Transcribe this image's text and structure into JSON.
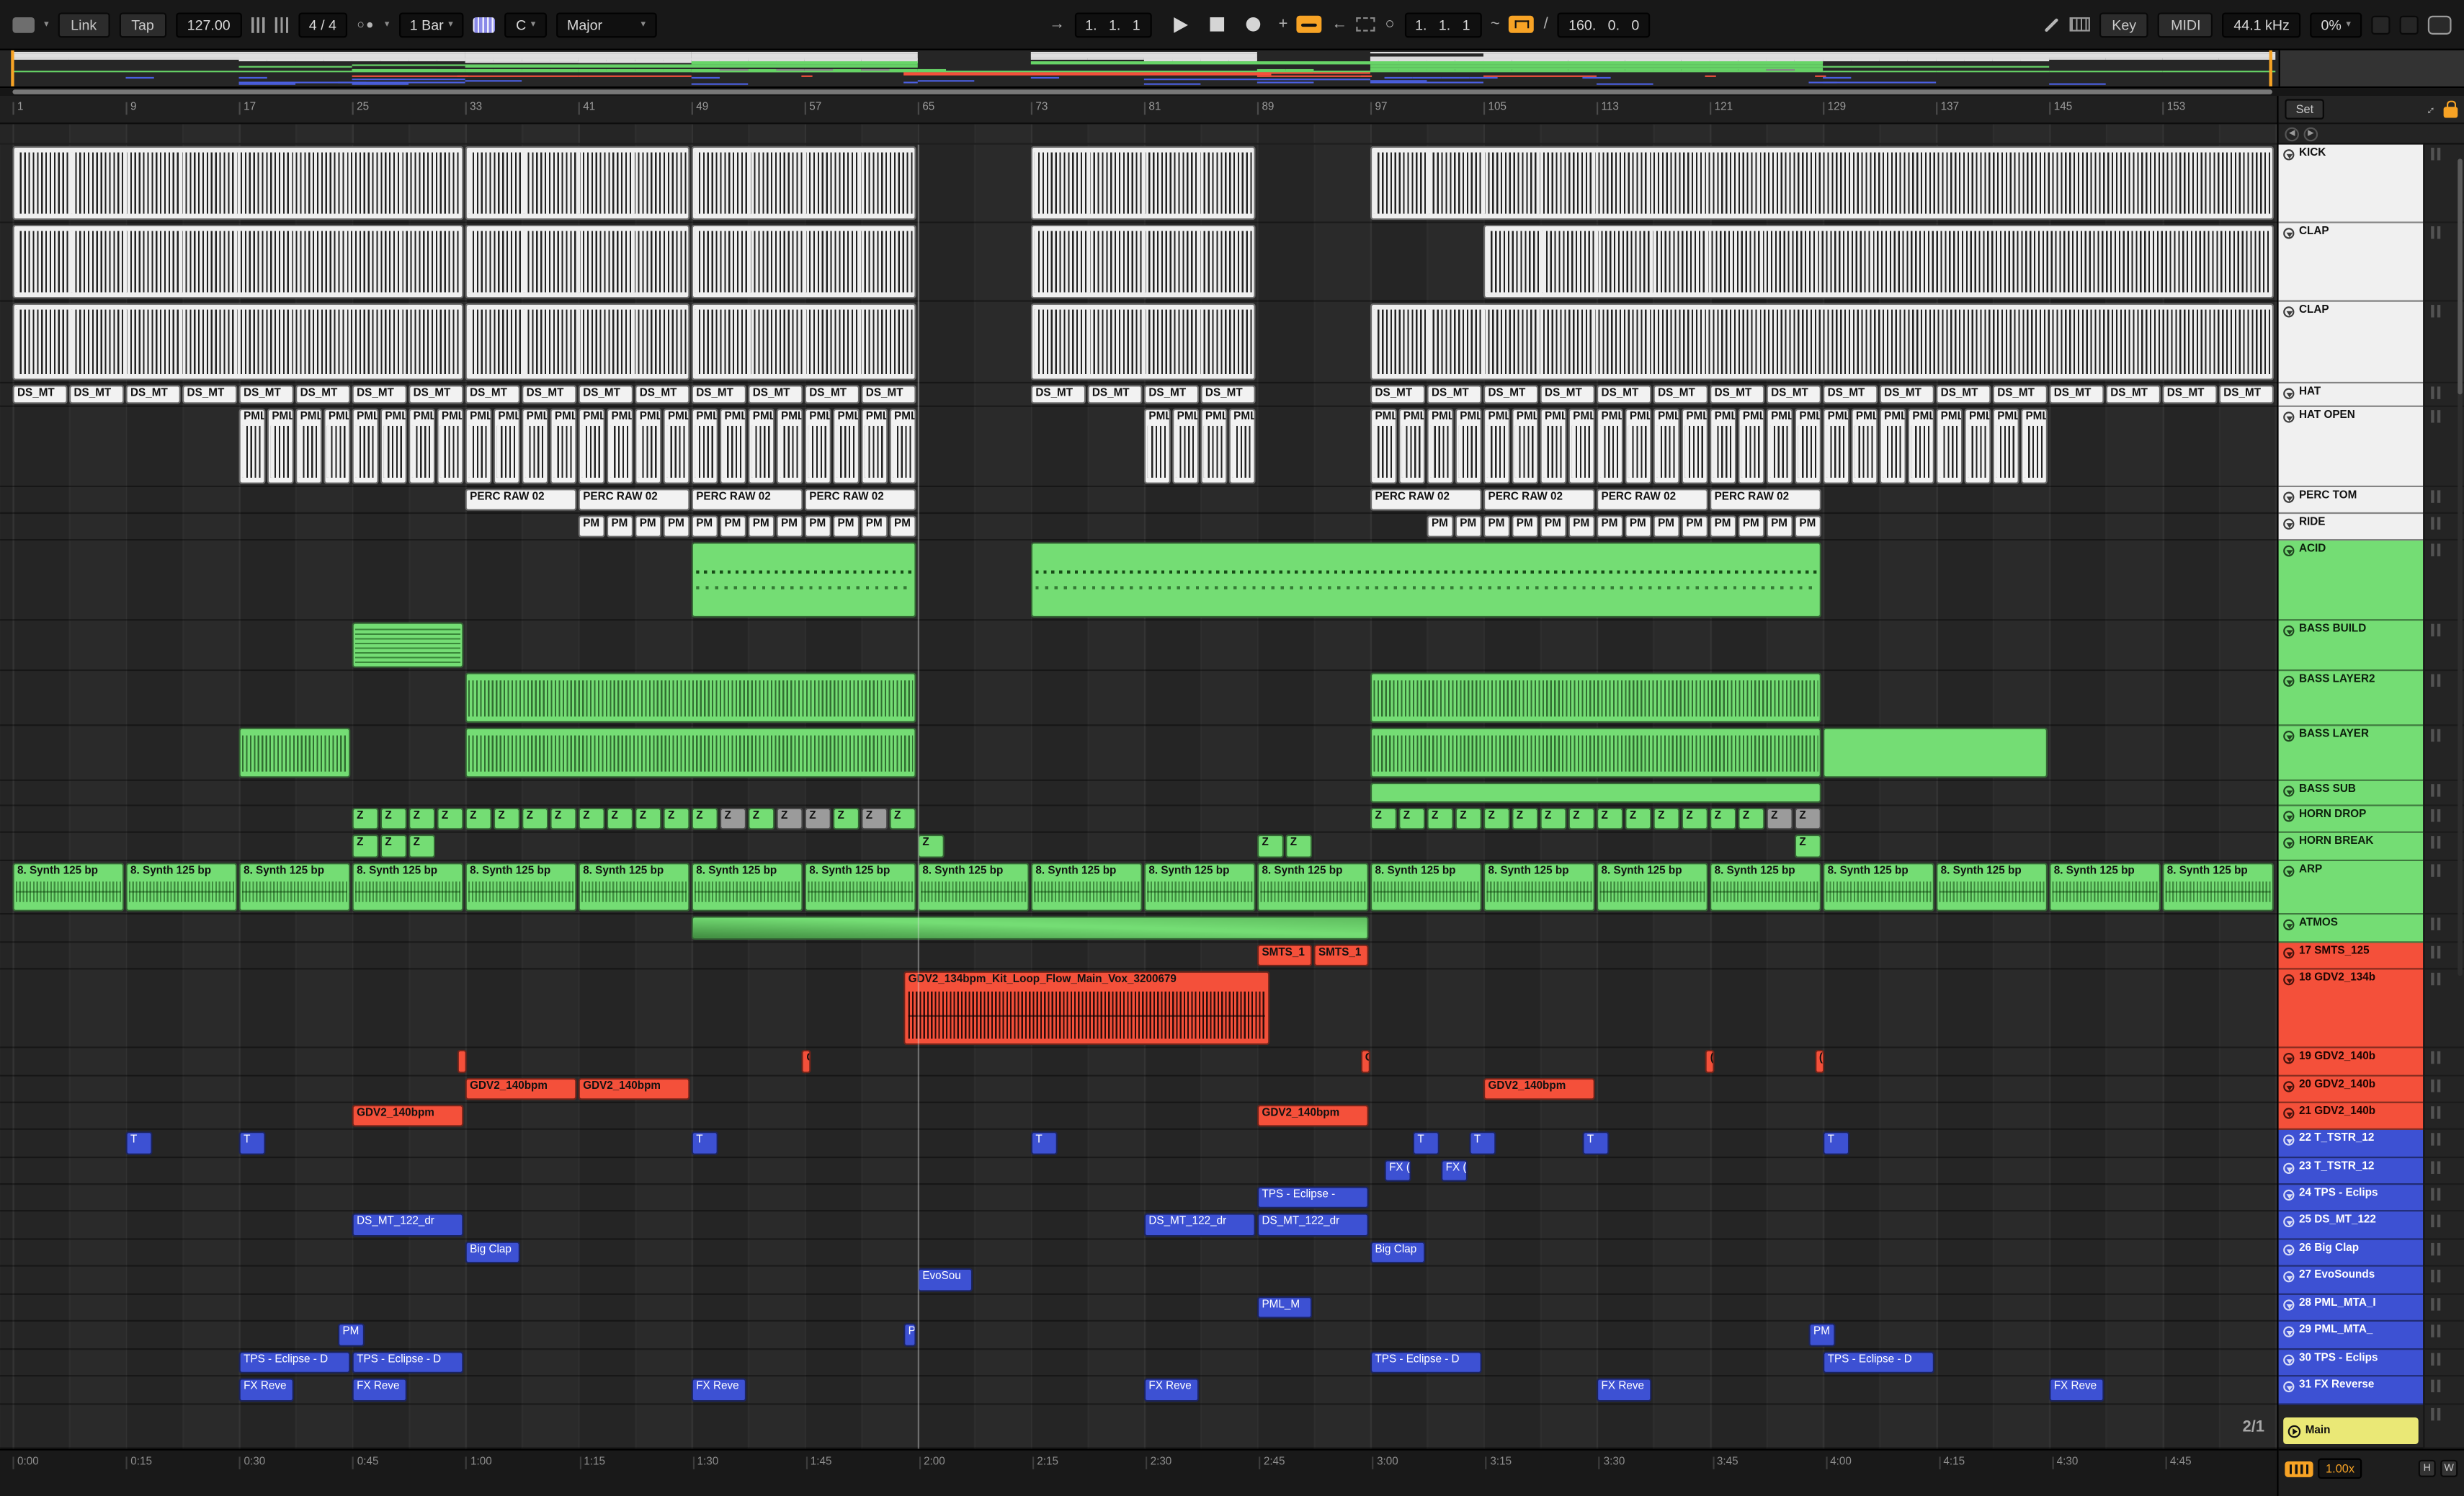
{
  "toolbar": {
    "link": "Link",
    "tap": "Tap",
    "tempo": "127.00",
    "time_sig": "4 / 4",
    "groove": "1 Bar",
    "root_note": "C",
    "scale_name": "Major",
    "arrangement_position": "1.   1.   1",
    "loop_start": "1.   1.   1",
    "loop_length": "160.   0.   0",
    "key_map": "Key",
    "midi_map": "MIDI",
    "sample_rate": "44.1 kHz",
    "cpu_load": "0%"
  },
  "arrangement": {
    "set_button": "Set",
    "grid_label": "2/1",
    "bars_total": 160,
    "ruler_bars": [
      1,
      9,
      17,
      25,
      33,
      41,
      49,
      57,
      65,
      73,
      81,
      89,
      97,
      105,
      113,
      121,
      129,
      137,
      145,
      153
    ],
    "time_labels": [
      "0:00",
      "0:15",
      "0:30",
      "0:45",
      "1:00",
      "1:15",
      "1:30",
      "1:45",
      "2:00",
      "2:15",
      "2:30",
      "2:45",
      "3:00",
      "3:15",
      "3:30",
      "3:45",
      "4:00",
      "4:15",
      "4:30",
      "4:45"
    ]
  },
  "status_bar": {
    "speed": "1.00x",
    "h": "H",
    "w": "W",
    "main": "Main"
  },
  "colors": {
    "light": "#f0f0f0",
    "green": "#74dd74",
    "red": "#f4503a",
    "blue": "#3d51d3",
    "yellow": "#eae876",
    "accent_orange": "#f7a325",
    "background": "#2a2a2a",
    "mini": {
      "light": "#dedede",
      "green": "#67d467",
      "red": "#f4513b",
      "blue": "#4a5fe0",
      "yellow": "#eae876"
    }
  },
  "tracks": [
    {
      "name": "KICK",
      "color": "light",
      "h": 50,
      "style": "wave-light",
      "clips": [
        {
          "s": 1,
          "l": 32
        },
        {
          "s": 33,
          "l": 16
        },
        {
          "s": 49,
          "l": 16
        },
        {
          "s": 73,
          "l": 16
        },
        {
          "s": 97,
          "l": 64
        }
      ]
    },
    {
      "name": "CLAP",
      "color": "light",
      "h": 50,
      "style": "wave-light",
      "clips": [
        {
          "s": 1,
          "l": 32
        },
        {
          "s": 33,
          "l": 16
        },
        {
          "s": 49,
          "l": 16
        },
        {
          "s": 73,
          "l": 16
        },
        {
          "s": 105,
          "l": 56
        }
      ]
    },
    {
      "name": "CLAP",
      "color": "light",
      "h": 52,
      "style": "wave-light",
      "clips": [
        {
          "s": 1,
          "l": 32
        },
        {
          "s": 33,
          "l": 16
        },
        {
          "s": 49,
          "l": 16
        },
        {
          "s": 73,
          "l": 16
        },
        {
          "s": 97,
          "l": 64
        }
      ]
    },
    {
      "name": "HAT",
      "color": "light",
      "h": 15,
      "style": "label-light",
      "clips": [
        {
          "run": {
            "s": 1,
            "count": 16,
            "step": 4,
            "l": 4,
            "label": "DS_MT"
          }
        },
        {
          "run": {
            "s": 73,
            "count": 4,
            "step": 4,
            "l": 4,
            "label": "DS_MT"
          }
        },
        {
          "run": {
            "s": 97,
            "count": 16,
            "step": 4,
            "l": 4,
            "label": "DS_MT"
          }
        }
      ]
    },
    {
      "name": "HAT OPEN",
      "color": "light",
      "h": 51,
      "style": "wave-light-label",
      "clips": [
        {
          "run": {
            "s": 17,
            "count": 24,
            "step": 2,
            "l": 2,
            "label": "PML_M"
          }
        },
        {
          "run": {
            "s": 81,
            "count": 4,
            "step": 2,
            "l": 2,
            "label": "PML_M"
          }
        },
        {
          "run": {
            "s": 97,
            "count": 24,
            "step": 2,
            "l": 2,
            "label": "PML_M"
          }
        }
      ]
    },
    {
      "name": "PERC TOM",
      "color": "light",
      "h": 17,
      "style": "label-light",
      "clips": [
        {
          "run": {
            "s": 33,
            "count": 4,
            "step": 8,
            "l": 8,
            "label": "PERC RAW 02"
          }
        },
        {
          "run": {
            "s": 97,
            "count": 4,
            "step": 8,
            "l": 8,
            "label": "PERC RAW 02"
          }
        }
      ]
    },
    {
      "name": "RIDE",
      "color": "light",
      "h": 17,
      "style": "label-light",
      "clips": [
        {
          "run": {
            "s": 41,
            "count": 12,
            "step": 2,
            "l": 2,
            "label": "PM"
          }
        },
        {
          "run": {
            "s": 101,
            "count": 14,
            "step": 2,
            "l": 2,
            "label": "PM"
          }
        }
      ]
    },
    {
      "name": "ACID",
      "color": "green",
      "h": 51,
      "style": "midi-green",
      "clips": [
        {
          "s": 49,
          "l": 16
        },
        {
          "s": 73,
          "l": 56
        }
      ]
    },
    {
      "name": "BASS BUILD",
      "color": "green",
      "h": 32,
      "style": "midi-green-dense",
      "clips": [
        {
          "s": 25,
          "l": 8
        }
      ]
    },
    {
      "name": "BASS LAYER2",
      "color": "green",
      "h": 35,
      "style": "wave-green",
      "clips": [
        {
          "s": 33,
          "l": 32
        },
        {
          "s": 97,
          "l": 32
        }
      ]
    },
    {
      "name": "BASS LAYER",
      "color": "green",
      "h": 35,
      "style": "wave-green",
      "clips": [
        {
          "s": 17,
          "l": 8
        },
        {
          "s": 33,
          "l": 32
        },
        {
          "s": 97,
          "l": 32
        },
        {
          "s": 129,
          "l": 16,
          "v": "plain"
        }
      ]
    },
    {
      "name": "BASS SUB",
      "color": "green",
      "h": 16,
      "style": "plain-green",
      "clips": [
        {
          "s": 97,
          "l": 32
        }
      ]
    },
    {
      "name": "HORN DROP",
      "color": "green",
      "h": 17,
      "style": "chip-green",
      "grey": [
        51,
        55,
        57,
        61,
        125,
        127
      ],
      "clips": [
        {
          "run": {
            "s": 25,
            "count": 20,
            "step": 2,
            "l": 2,
            "label": "Z"
          }
        },
        {
          "run": {
            "s": 97,
            "count": 16,
            "step": 2,
            "l": 2,
            "label": "Z"
          }
        }
      ]
    },
    {
      "name": "HORN BREAK",
      "color": "green",
      "h": 18,
      "style": "chip-green",
      "clips": [
        {
          "s": 25,
          "l": 2,
          "label": "Z"
        },
        {
          "s": 27,
          "l": 2,
          "label": "Z"
        },
        {
          "s": 29,
          "l": 2,
          "label": "Z"
        },
        {
          "s": 65,
          "l": 2,
          "label": "Z"
        },
        {
          "s": 89,
          "l": 2,
          "label": "Z"
        },
        {
          "s": 91,
          "l": 2,
          "label": "Z"
        },
        {
          "s": 127,
          "l": 2,
          "label": "Z"
        }
      ]
    },
    {
      "name": "ARP",
      "color": "green",
      "h": 34,
      "style": "arp-green",
      "clips": [
        {
          "run": {
            "s": 1,
            "count": 20,
            "step": 8,
            "l": 8,
            "label": "8. Synth 125 bp"
          }
        }
      ]
    },
    {
      "name": "ATMOS",
      "color": "green",
      "h": 18,
      "style": "fade-green",
      "clips": [
        {
          "s": 49,
          "l": 48
        }
      ]
    },
    {
      "name": "17 SMTS_125",
      "color": "red",
      "h": 17,
      "style": "label-red",
      "clips": [
        {
          "s": 89,
          "l": 4,
          "label": "SMTS_1"
        },
        {
          "s": 93,
          "l": 4,
          "label": "SMTS_1"
        }
      ]
    },
    {
      "name": "18 GDV2_134b",
      "color": "red",
      "h": 50,
      "style": "wave-red",
      "clips": [
        {
          "s": 64,
          "l": 26,
          "label": "GDV2_134bpm_Kit_Loop_Flow_Main_Vox_3200679"
        }
      ]
    },
    {
      "name": "19 GDV2_140b",
      "color": "red",
      "h": 18,
      "style": "label-red",
      "clips": [
        {
          "s": 32.4,
          "l": 0.8
        },
        {
          "s": 56.8,
          "l": 0.8,
          "label": "G"
        },
        {
          "s": 96.3,
          "l": 0.8,
          "label": "G"
        },
        {
          "s": 120.7,
          "l": 0.8,
          "label": "("
        },
        {
          "s": 128.4,
          "l": 0.8,
          "label": "("
        }
      ]
    },
    {
      "name": "20 GDV2_140b",
      "color": "red",
      "h": 17,
      "style": "label-red",
      "clips": [
        {
          "s": 33,
          "l": 8,
          "label": "GDV2_140bpm"
        },
        {
          "s": 41,
          "l": 8,
          "label": "GDV2_140bpm"
        },
        {
          "s": 105,
          "l": 8,
          "label": "GDV2_140bpm"
        }
      ]
    },
    {
      "name": "21 GDV2_140b",
      "color": "red",
      "h": 17,
      "style": "label-red",
      "clips": [
        {
          "s": 25,
          "l": 8,
          "label": "GDV2_140bpm"
        },
        {
          "s": 89,
          "l": 8,
          "label": "GDV2_140bpm"
        }
      ]
    },
    {
      "name": "22 T_TSTR_12",
      "color": "blue",
      "h": 18,
      "style": "label-blue",
      "clips": [
        {
          "s": 9,
          "l": 2,
          "label": "T"
        },
        {
          "s": 17,
          "l": 2,
          "label": "T"
        },
        {
          "s": 49,
          "l": 2,
          "label": "T"
        },
        {
          "s": 73,
          "l": 2,
          "label": "T"
        },
        {
          "s": 100,
          "l": 2,
          "label": "T"
        },
        {
          "s": 104,
          "l": 2,
          "label": "T"
        },
        {
          "s": 112,
          "l": 2,
          "label": "T"
        },
        {
          "s": 129,
          "l": 2,
          "label": "T"
        }
      ]
    },
    {
      "name": "23 T_TSTR_12",
      "color": "blue",
      "h": 17,
      "style": "label-blue",
      "clips": [
        {
          "s": 98,
          "l": 2,
          "label": "FX ("
        },
        {
          "s": 102,
          "l": 2,
          "label": "FX ("
        }
      ]
    },
    {
      "name": "24 TPS - Eclips",
      "color": "blue",
      "h": 17,
      "style": "label-blue",
      "clips": [
        {
          "s": 89,
          "l": 8,
          "label": "TPS - Eclipse -"
        }
      ]
    },
    {
      "name": "25 DS_MT_122",
      "color": "blue",
      "h": 18,
      "style": "label-blue",
      "clips": [
        {
          "s": 25,
          "l": 8,
          "label": "DS_MT_122_dr"
        },
        {
          "s": 81,
          "l": 8,
          "label": "DS_MT_122_dr"
        },
        {
          "s": 89,
          "l": 8,
          "label": "DS_MT_122_dr"
        }
      ]
    },
    {
      "name": "26 Big Clap",
      "color": "blue",
      "h": 17,
      "style": "label-blue",
      "clips": [
        {
          "s": 33,
          "l": 4,
          "label": "Big Clap"
        },
        {
          "s": 97,
          "l": 4,
          "label": "Big Clap"
        }
      ]
    },
    {
      "name": "27 EvoSounds",
      "color": "blue",
      "h": 18,
      "style": "label-blue",
      "clips": [
        {
          "s": 65,
          "l": 4,
          "label": "EvoSou"
        }
      ]
    },
    {
      "name": "28 PML_MTA_I",
      "color": "blue",
      "h": 17,
      "style": "label-blue",
      "clips": [
        {
          "s": 89,
          "l": 4,
          "label": "PML_M"
        }
      ]
    },
    {
      "name": "29 PML_MTA_",
      "color": "blue",
      "h": 18,
      "style": "label-blue",
      "clips": [
        {
          "s": 24,
          "l": 2,
          "label": "PM"
        },
        {
          "s": 64,
          "l": 1,
          "label": "P"
        },
        {
          "s": 128,
          "l": 2,
          "label": "PM"
        }
      ]
    },
    {
      "name": "30 TPS - Eclips",
      "color": "blue",
      "h": 17,
      "style": "label-blue",
      "clips": [
        {
          "s": 17,
          "l": 8,
          "label": "TPS - Eclipse - D"
        },
        {
          "s": 25,
          "l": 8,
          "label": "TPS - Eclipse - D"
        },
        {
          "s": 97,
          "l": 8,
          "label": "TPS - Eclipse - D"
        },
        {
          "s": 129,
          "l": 8,
          "label": "TPS - Eclipse - D"
        }
      ]
    },
    {
      "name": "31 FX Reverse",
      "color": "blue",
      "h": 18,
      "style": "label-blue",
      "clips": [
        {
          "s": 17,
          "l": 4,
          "label": "FX Reve"
        },
        {
          "s": 25,
          "l": 4,
          "label": "FX Reve"
        },
        {
          "s": 49,
          "l": 4,
          "label": "FX Reve"
        },
        {
          "s": 81,
          "l": 4,
          "label": "FX Reve"
        },
        {
          "s": 113,
          "l": 4,
          "label": "FX Reve"
        },
        {
          "s": 145,
          "l": 4,
          "label": "FX Reve"
        }
      ]
    },
    {
      "name": "Main",
      "color": "yellow",
      "h": 28,
      "style": "none",
      "main": true,
      "clips": []
    }
  ]
}
